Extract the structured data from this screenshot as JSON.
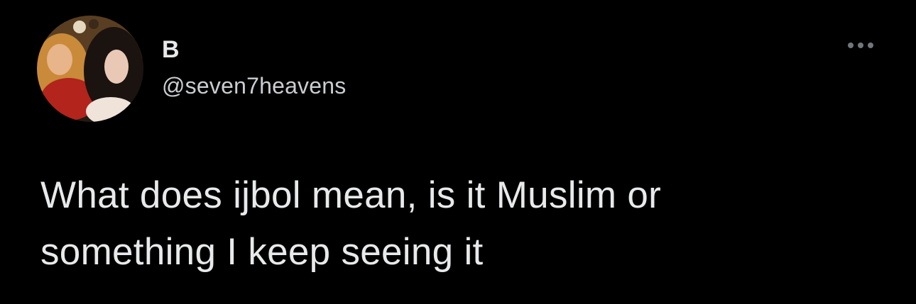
{
  "tweet": {
    "author": {
      "display_name": "B",
      "handle": "@seven7heavens",
      "avatar_icon": "profile-photo"
    },
    "more_icon": "ellipsis-icon",
    "text": "What does ijbol mean, is it Muslim or\nsomething I keep seeing it"
  },
  "colors": {
    "background": "#000000",
    "primary_text": "#e7e9ea",
    "secondary_text": "#c9cdd1",
    "icon_gray": "#71767b"
  }
}
